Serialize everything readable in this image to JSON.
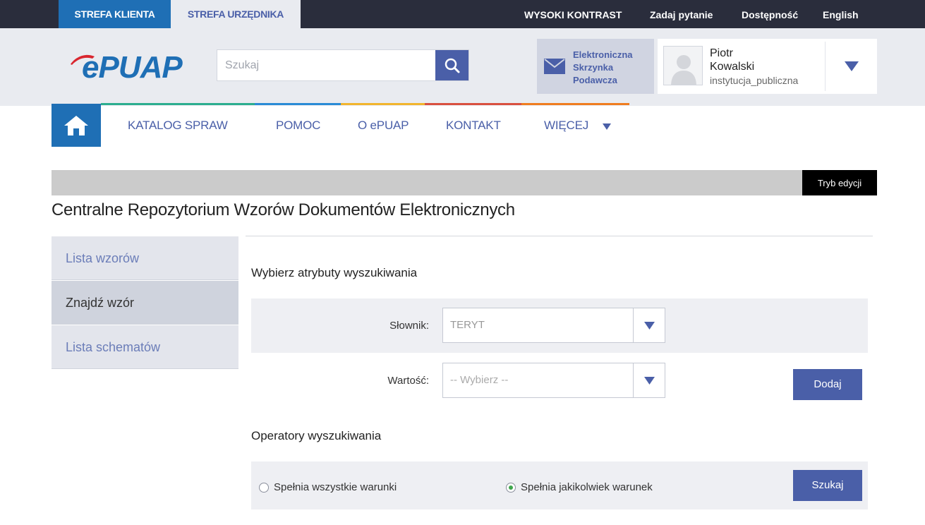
{
  "topbar": {
    "zone_client": "STREFA KLIENTA",
    "zone_official": "STREFA URZĘDNIKA",
    "links": [
      "WYSOKI KONTRAST",
      "Zadaj pytanie",
      "Dostępność",
      "English"
    ]
  },
  "header": {
    "logo_text": "ePUAP",
    "search_placeholder": "Szukaj",
    "esp_lines": [
      "Elektroniczna",
      "Skrzynka",
      "Podawcza"
    ],
    "user_first": "Piotr",
    "user_last": "Kowalski",
    "user_role": "instytucja_publiczna"
  },
  "nav": {
    "items": [
      "KATALOG SPRAW",
      "POMOC",
      "O ePUAP",
      "KONTAKT",
      "WIĘCEJ"
    ],
    "colors": [
      "#2cae8f",
      "#2a8bd6",
      "#f1b52e",
      "#d9503f",
      "#ef7d1f"
    ]
  },
  "editbar": {
    "button": "Tryb edycji"
  },
  "page": {
    "title": "Centralne Repozytorium Wzorów Dokumentów Elektronicznych"
  },
  "sidebar": {
    "items": [
      "Lista wzorów",
      "Znajdź wzór",
      "Lista schematów"
    ],
    "active_index": 1
  },
  "search_form": {
    "attributes_heading": "Wybierz atrybuty wyszukiwania",
    "dictionary_label": "Słownik:",
    "dictionary_value": "TERYT",
    "value_label": "Wartość:",
    "value_placeholder": "-- Wybierz --",
    "add_button": "Dodaj",
    "operators_heading": "Operatory wyszukiwania",
    "radio_all": "Spełnia wszystkie warunki",
    "radio_any": "Spełnia jakikolwiek warunek",
    "selected_operator": "any",
    "search_button": "Szukaj"
  }
}
